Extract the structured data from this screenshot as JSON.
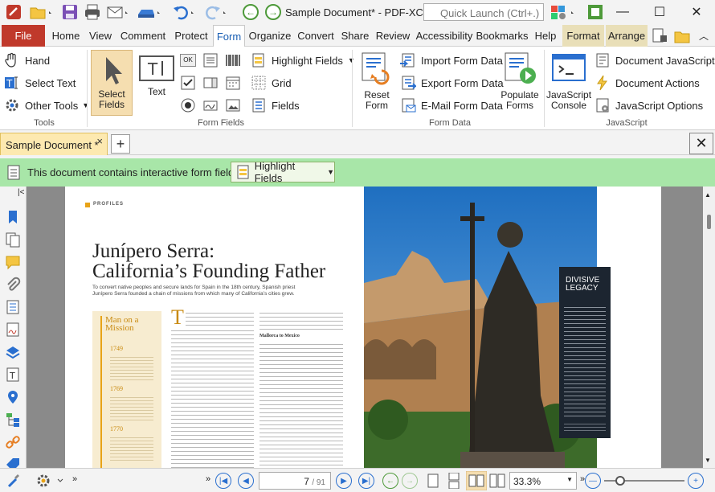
{
  "titlebar": {
    "document_title": "Sample Document* - PDF-XCh...",
    "quick_launch_placeholder": "Quick Launch (Ctrl+.)",
    "minimize": "—",
    "maximize": "☐",
    "close": "✕"
  },
  "ribbon_tabs": [
    {
      "label": "File"
    },
    {
      "label": "Home"
    },
    {
      "label": "View"
    },
    {
      "label": "Comment"
    },
    {
      "label": "Protect"
    },
    {
      "label": "Form"
    },
    {
      "label": "Organize"
    },
    {
      "label": "Convert"
    },
    {
      "label": "Share"
    },
    {
      "label": "Review"
    },
    {
      "label": "Accessibility"
    },
    {
      "label": "Bookmarks"
    },
    {
      "label": "Help"
    },
    {
      "label": "Format"
    },
    {
      "label": "Arrange"
    }
  ],
  "ribbon": {
    "tools": {
      "label": "Tools",
      "hand": "Hand",
      "select_text": "Select Text",
      "other_tools": "Other Tools"
    },
    "form_fields": {
      "label": "Form Fields",
      "select_fields": "Select Fields",
      "text": "Text",
      "highlight_fields": "Highlight Fields",
      "grid": "Grid",
      "fields": "Fields"
    },
    "form_data": {
      "label": "Form Data",
      "import": "Import Form Data",
      "export": "Export Form Data",
      "email": "E-Mail Form Data",
      "reset_1": "Reset",
      "reset_2": "Form",
      "populate_1": "Populate",
      "populate_2": "Forms"
    },
    "javascript": {
      "label": "JavaScript",
      "console_1": "JavaScript",
      "console_2": "Console",
      "doc_js": "Document JavaScript",
      "doc_actions": "Document Actions",
      "js_options": "JavaScript Options"
    }
  },
  "document_tab": {
    "label": "Sample Document *",
    "close": "×",
    "new": "+"
  },
  "form_bar": {
    "message": "This document contains interactive form fields.",
    "button": "Highlight Fields"
  },
  "page": {
    "section": "PROFILES",
    "title_1": "Junípero Serra:",
    "title_2": "California’s Founding Father",
    "subtitle_1": "To convert native peoples and secure lands for Spain in the 18th century, Spanish priest",
    "subtitle_2": "Junípero Serra founded a chain of missions from which many of California’s cities grew.",
    "sidebar_title": "Man on a Mission",
    "sidebar_years": [
      "1749",
      "1769",
      "1770"
    ],
    "col2_heading": "Mallorca to Mexico",
    "right_box_title": "DIVISIVE LEGACY"
  },
  "status": {
    "page_current": "7",
    "page_total": "/ 91",
    "zoom": "33.3%"
  }
}
